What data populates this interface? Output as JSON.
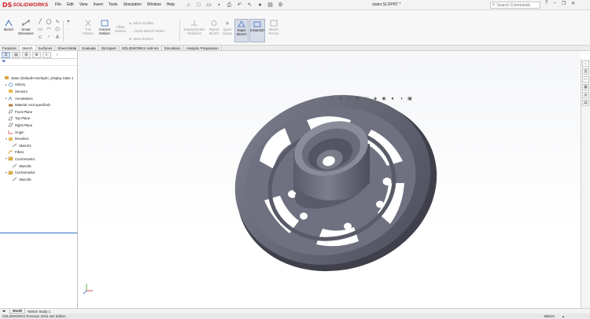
{
  "app": {
    "brand": "SOLIDWORKS",
    "logo_prefix": "DS",
    "document_title": "stator.SLDPRT *"
  },
  "menu": [
    "File",
    "Edit",
    "View",
    "Insert",
    "Tools",
    "Simulation",
    "Window",
    "Help"
  ],
  "search": {
    "placeholder": "Search Commands"
  },
  "ribbon": {
    "sketch": "Sketch",
    "smart_dimension": [
      "Smart",
      "Dimension"
    ],
    "trim_entities": [
      "Trim",
      "Entities"
    ],
    "convert_entities": [
      "Convert",
      "Entities"
    ],
    "offset_entities": [
      "Offset",
      "Entities"
    ],
    "mirror_entities": "Mirror Entities",
    "linear_sketch_pattern": "Linear Sketch Pattern",
    "move_entities": "Move Entities",
    "display_delete_relations": [
      "Display/Delete",
      "Relations"
    ],
    "repair_sketch": [
      "Repair",
      "Sketch"
    ],
    "quick_snaps": [
      "Quick",
      "Snaps"
    ],
    "rapid_sketch": [
      "Rapid",
      "Sketch"
    ],
    "instant2d": "Instant2D",
    "sketch_picture": [
      "Sketch",
      "Picture"
    ]
  },
  "command_tabs": [
    "Features",
    "Sketch",
    "Surfaces",
    "Sheet Metal",
    "Evaluate",
    "DimXpert",
    "SOLIDWORKS Add-Ins",
    "Simulation",
    "Analysis Preparation"
  ],
  "active_tab": "Sketch",
  "feature_tree": [
    {
      "label": "stator  (Default<<Default>_Display State 1",
      "icon": "part-icon",
      "depth": 0,
      "expander": ""
    },
    {
      "label": "History",
      "icon": "history-icon",
      "depth": 1,
      "expander": "▸"
    },
    {
      "label": "Sensors",
      "icon": "sensors-icon",
      "depth": 1,
      "expander": ""
    },
    {
      "label": "Annotations",
      "icon": "annotations-icon",
      "depth": 1,
      "expander": "▸"
    },
    {
      "label": "Material <not specified>",
      "icon": "material-icon",
      "depth": 1,
      "expander": ""
    },
    {
      "label": "Front Plane",
      "icon": "plane-icon",
      "depth": 1,
      "expander": ""
    },
    {
      "label": "Top Plane",
      "icon": "plane-icon",
      "depth": 1,
      "expander": ""
    },
    {
      "label": "Right Plane",
      "icon": "plane-icon",
      "depth": 1,
      "expander": ""
    },
    {
      "label": "Origin",
      "icon": "origin-icon",
      "depth": 1,
      "expander": ""
    },
    {
      "label": "Revolve1",
      "icon": "revolve-icon",
      "depth": 1,
      "expander": "▾"
    },
    {
      "label": "Sketch1",
      "icon": "sketch-icon",
      "depth": 2,
      "expander": ""
    },
    {
      "label": "Fillet1",
      "icon": "fillet-icon",
      "depth": 1,
      "expander": ""
    },
    {
      "label": "Cut-Extrude1",
      "icon": "cut-extrude-icon",
      "depth": 1,
      "expander": "▾"
    },
    {
      "label": "Sketch5",
      "icon": "sketch-icon",
      "depth": 2,
      "expander": ""
    },
    {
      "label": "Cut-Extrude2",
      "icon": "cut-extrude-icon",
      "depth": 1,
      "expander": "▾"
    },
    {
      "label": "Sketch6",
      "icon": "sketch-icon",
      "depth": 2,
      "expander": ""
    }
  ],
  "model_tabs": [
    "Model",
    "Motion Study 1"
  ],
  "status": {
    "edition": "SOLIDWORKS Premium 2016 x64 Edition",
    "units": "MMGS"
  },
  "colors": {
    "accent": "#2f6fbf",
    "brand_red": "#d4232b",
    "model_face": "#6e6f7d",
    "model_dark": "#4a4b58",
    "model_light": "#8a8b99"
  }
}
